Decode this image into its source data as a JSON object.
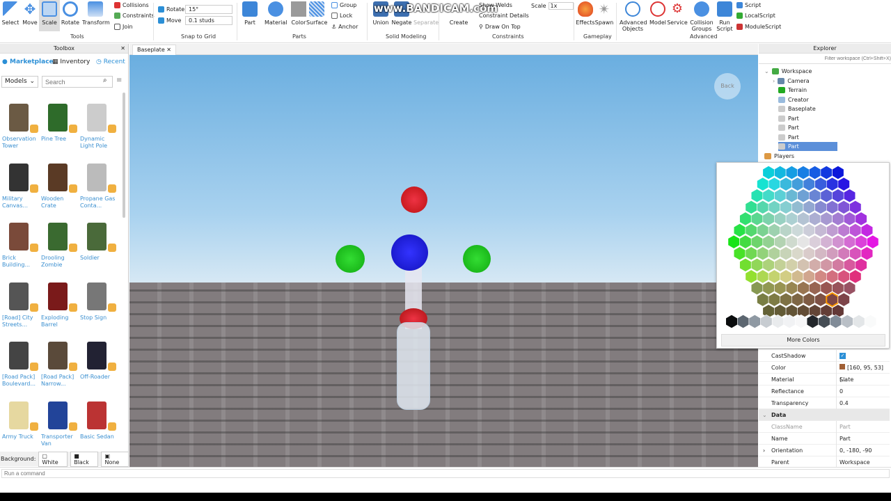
{
  "ribbon": {
    "tools": [
      {
        "label": "Select"
      },
      {
        "label": "Move"
      },
      {
        "label": "Scale"
      },
      {
        "label": "Rotate"
      },
      {
        "label": "Transform"
      }
    ],
    "tools_extra": [
      "Collisions",
      "Constraints",
      "Join"
    ],
    "tools_group": "Tools",
    "snap": {
      "rotate_label": "Rotate",
      "rotate_value": "15°",
      "move_label": "Move",
      "move_value": "0.1 studs",
      "group": "Snap to Grid"
    },
    "parts": {
      "items": [
        "Part",
        "Material",
        "Color",
        "Surface"
      ],
      "extra": [
        "Group",
        "Lock",
        "Anchor"
      ],
      "group": "Parts"
    },
    "solid": {
      "items": [
        "Union",
        "Negate",
        "Separate"
      ],
      "group": "Solid Modeling"
    },
    "constraints": {
      "create": "Create",
      "extra": [
        "Show Welds",
        "Constraint Details",
        "Draw On Top"
      ],
      "scale_label": "Scale",
      "scale_value": "1x",
      "group": "Constraints"
    },
    "gameplay": {
      "items": [
        "Effects",
        "Spawn"
      ],
      "group": "Gameplay"
    },
    "advanced": {
      "items": [
        "Advanced Objects",
        "Model",
        "Service",
        "Collision Groups",
        "Run Script"
      ],
      "scripts": [
        "Script",
        "LocalScript",
        "ModuleScript"
      ],
      "group": "Advanced"
    },
    "watermark": "www.BANDICAM.com"
  },
  "toolbox": {
    "title": "Toolbox",
    "tabs": [
      "Marketplace",
      "Inventory",
      "Recent"
    ],
    "category": "Models",
    "search_placeholder": "Search",
    "items": [
      "Observation Tower",
      "Pine Tree",
      "Dynamic Light Pole",
      "Military Canvas...",
      "Wooden Crate",
      "Propane Gas Conta...",
      "Brick Building...",
      "Drooling Zombie",
      "Soldier",
      "[Road] City Streets...",
      "Exploding Barrel",
      "Stop Sign",
      "[Road Pack] Boulevard...",
      "[Road Pack] Narrow...",
      "Off-Roader",
      "Army Truck",
      "Transporter Van",
      "Basic Sedan"
    ],
    "background_label": "Background:",
    "background_options": [
      "White",
      "Black",
      "None"
    ]
  },
  "viewport": {
    "tab": "Baseplate",
    "back_button": "Back"
  },
  "explorer": {
    "title": "Explorer",
    "filter_placeholder": "Filter workspace (Ctrl+Shift+X)",
    "items": [
      "Workspace",
      "Camera",
      "Terrain",
      "Creator",
      "Baseplate",
      "Part",
      "Part",
      "Part",
      "Part",
      "Players"
    ]
  },
  "color_picker": {
    "more_colors": "More Colors"
  },
  "properties": {
    "rows": [
      {
        "key": "CastShadow",
        "value": "checked"
      },
      {
        "key": "Color",
        "value": "[160, 95, 53] (..."
      },
      {
        "key": "Material",
        "value": "Slate"
      },
      {
        "key": "Reflectance",
        "value": "0"
      },
      {
        "key": "Transparency",
        "value": "0.4"
      }
    ],
    "section": "Data",
    "data_rows": [
      {
        "key": "ClassName",
        "value": "Part"
      },
      {
        "key": "Name",
        "value": "Part"
      },
      {
        "key": "Orientation",
        "value": "0, -180, -90"
      },
      {
        "key": "Parent",
        "value": "Workspace"
      }
    ],
    "color_swatch": "#a05f35"
  },
  "command_bar": {
    "placeholder": "Run a command"
  }
}
